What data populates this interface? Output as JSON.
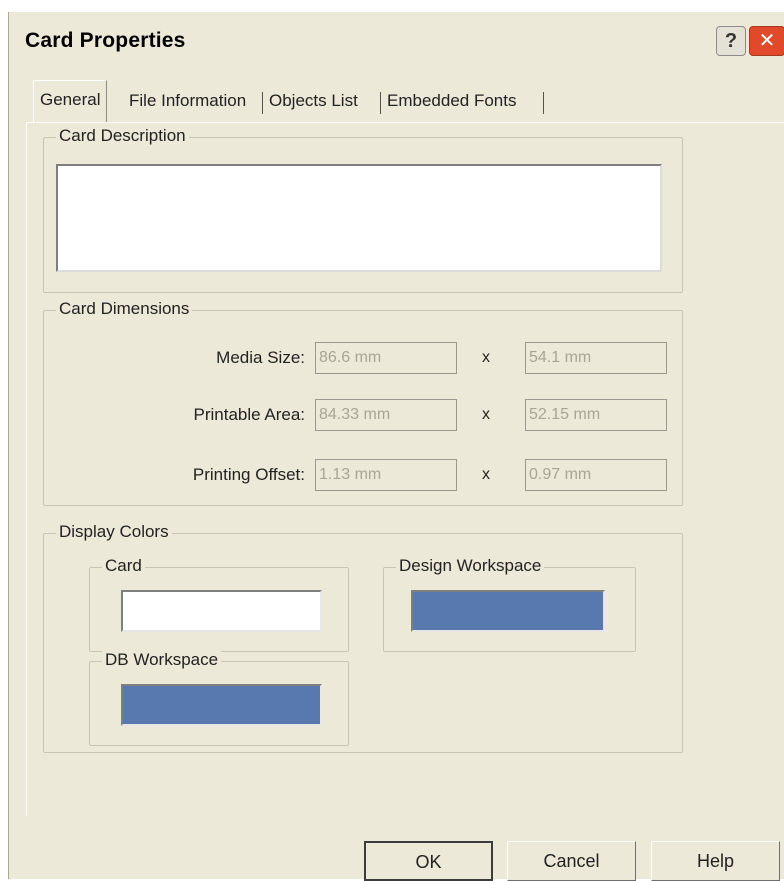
{
  "window": {
    "title": "Card Properties",
    "help_glyph": "?",
    "close_glyph": "✕"
  },
  "tabs": [
    {
      "label": "General",
      "active": true
    },
    {
      "label": "File Information"
    },
    {
      "label": "Objects List"
    },
    {
      "label": "Embedded Fonts"
    }
  ],
  "card_description": {
    "legend": "Card Description",
    "value": ""
  },
  "card_dimensions": {
    "legend": "Card Dimensions",
    "times_symbol": "x",
    "rows": [
      {
        "label": "Media Size:",
        "width": "86.6 mm",
        "height": "54.1 mm"
      },
      {
        "label": "Printable Area:",
        "width": "84.33 mm",
        "height": "52.15 mm"
      },
      {
        "label": "Printing Offset:",
        "width": "1.13 mm",
        "height": "0.97 mm"
      }
    ]
  },
  "display_colors": {
    "legend": "Display Colors",
    "card": {
      "label": "Card",
      "color": "#ffffff"
    },
    "design_workspace": {
      "label": "Design Workspace",
      "color": "#5878b0"
    },
    "db_workspace": {
      "label": "DB Workspace",
      "color": "#5878b0"
    }
  },
  "buttons": {
    "ok": "OK",
    "cancel": "Cancel",
    "help": "Help"
  }
}
